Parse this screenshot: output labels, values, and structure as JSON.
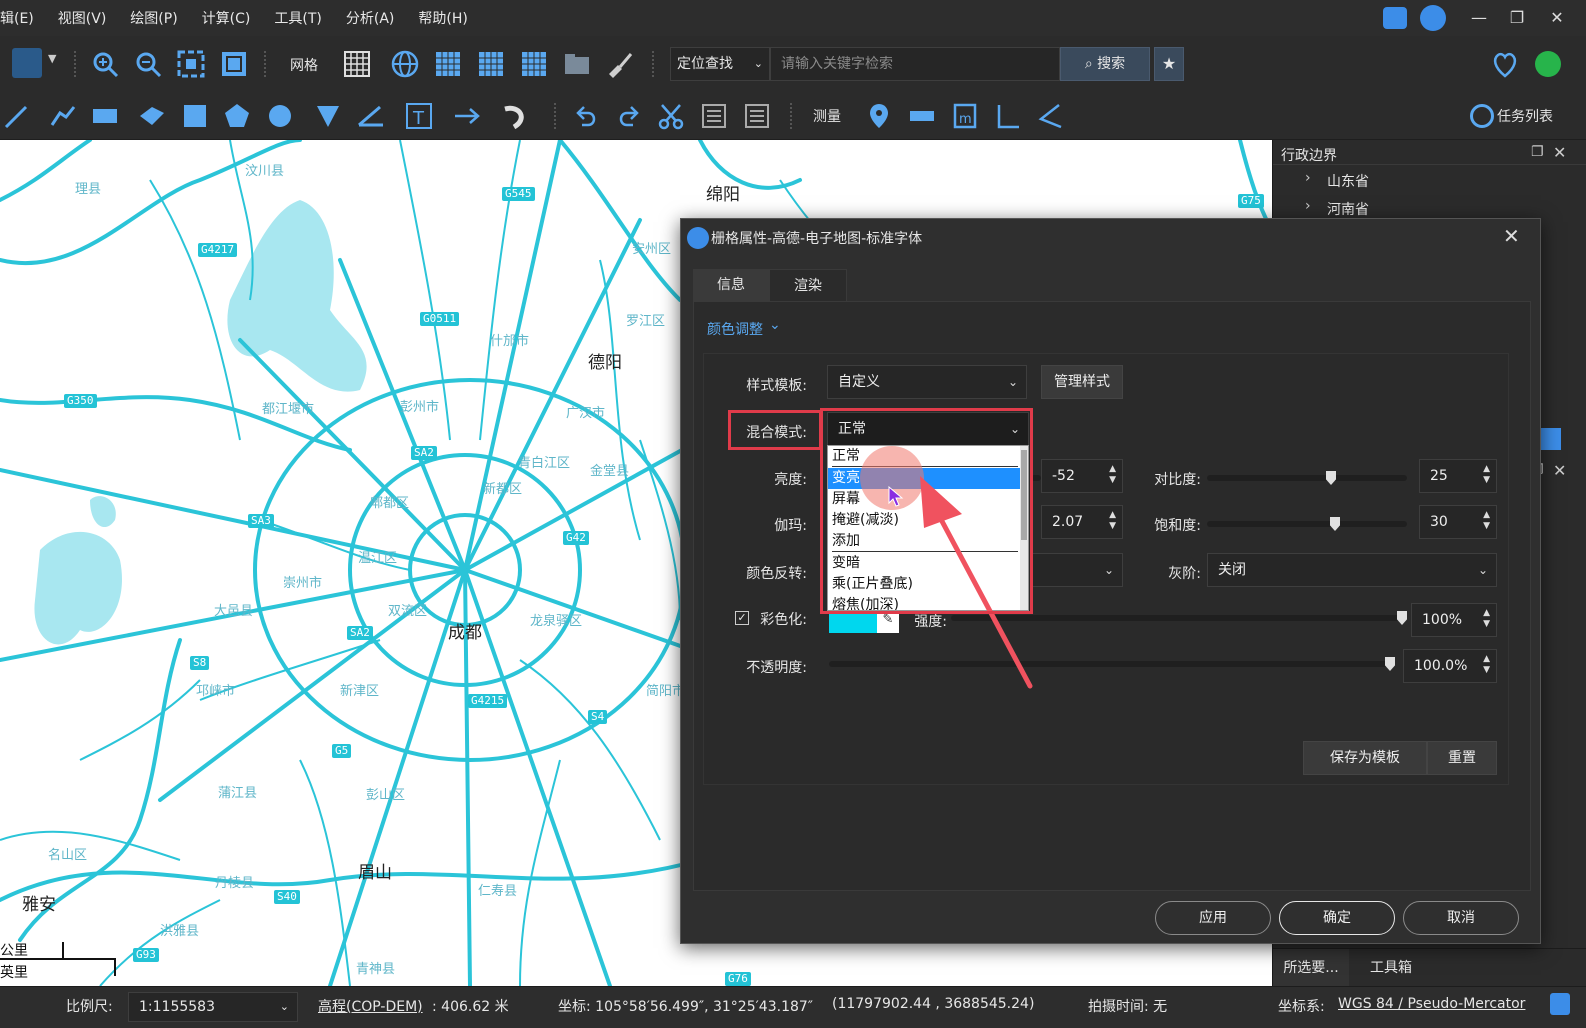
{
  "menubar": {
    "items": [
      "辑(E)",
      "视图(V)",
      "绘图(P)",
      "计算(C)",
      "工具(T)",
      "分析(A)",
      "帮助(H)"
    ]
  },
  "toolbar1": {
    "grid_label": "网格",
    "locate_select": "定位查找",
    "search_placeholder": "请输入关键字检索",
    "search_button": "搜索"
  },
  "toolbar2": {
    "measure_label": "测量",
    "task_list": "任务列表"
  },
  "map": {
    "places": [
      "理县",
      "汶川县",
      "绵阳",
      "德阳",
      "什邡市",
      "都江堰市",
      "彭州市",
      "新都区",
      "郫都区",
      "青白江区",
      "金堂县",
      "温江区",
      "成都",
      "双流区",
      "崇州市",
      "大邑县",
      "新津区",
      "邛崃市",
      "蒲江县",
      "眉山",
      "丹棱县",
      "洪雅县",
      "名山区",
      "雅安",
      "彭山区",
      "仁寿县",
      "青神县",
      "简阳市",
      "龙泉驿区",
      "罗江区",
      "广汉市",
      "安州区"
    ],
    "highway_shields": [
      "G545",
      "G4217",
      "G0511",
      "G350",
      "SA2",
      "SA3",
      "G42",
      "S8",
      "G5",
      "G4215",
      "S4",
      "S40",
      "G93",
      "G75",
      "G76",
      "SA2"
    ],
    "scale_top": "公里",
    "scale_bottom": "英里"
  },
  "right_panel": {
    "title": "行政边界",
    "items": [
      "山东省",
      "河南省"
    ],
    "bottom_tabs": [
      "所选要...",
      "工具箱"
    ]
  },
  "dialog": {
    "title": "栅格属性-高德-电子地图-标准字体",
    "tabs": [
      "信息",
      "渲染"
    ],
    "section": "颜色调整",
    "style_template_label": "样式模板:",
    "style_template_value": "自定义",
    "manage_style": "管理样式",
    "blend_mode_label": "混合模式:",
    "blend_mode_value": "正常",
    "brightness_label": "亮度:",
    "brightness_value": "-52",
    "contrast_label": "对比度:",
    "contrast_value": "25",
    "gamma_label": "伽玛:",
    "gamma_value": "2.07",
    "saturation_label": "饱和度:",
    "saturation_value": "30",
    "invert_label": "颜色反转:",
    "grayscale_label": "灰阶:",
    "grayscale_value": "关闭",
    "colorize_label": "彩色化:",
    "colorize_checked": true,
    "colorize_color": "#00d7ee",
    "strength_label": "强度:",
    "strength_value": "100%",
    "strength_fraction": 1.0,
    "opacity_label": "不透明度:",
    "opacity_value": "100.0%",
    "opacity_fraction": 1.0,
    "brightness_fraction": 0.6,
    "contrast_fraction": 0.62,
    "gamma_fraction": 0.6,
    "saturation_fraction": 0.64,
    "save_template": "保存为模板",
    "reset": "重置",
    "apply": "应用",
    "ok": "确定",
    "cancel": "取消"
  },
  "blend_dropdown": {
    "options": [
      "正常",
      "变亮",
      "屏幕",
      "掩避(减淡)",
      "添加",
      "变暗",
      "乘(正片叠底)",
      "熔焦(加深)"
    ],
    "highlighted": "变亮"
  },
  "status": {
    "scale_label": "比例尺:",
    "scale_value": "1:1155583",
    "elevation_label": "高程(COP-DEM)",
    "elevation_value": ": 406.62 米",
    "coord_label": "坐标: 105°58′56.499″, 31°25′43.187″",
    "coord_xy": "(11797902.44 , 3688545.24)",
    "capture_time": "拍摄时间: 无",
    "crs_label": "坐标系:",
    "crs_value": "WGS 84 / Pseudo-Mercator"
  },
  "colors": {
    "accent_blue": "#1e90ff",
    "highlight_red": "#e03b4a",
    "road_cyan": "#2bc4d8"
  }
}
